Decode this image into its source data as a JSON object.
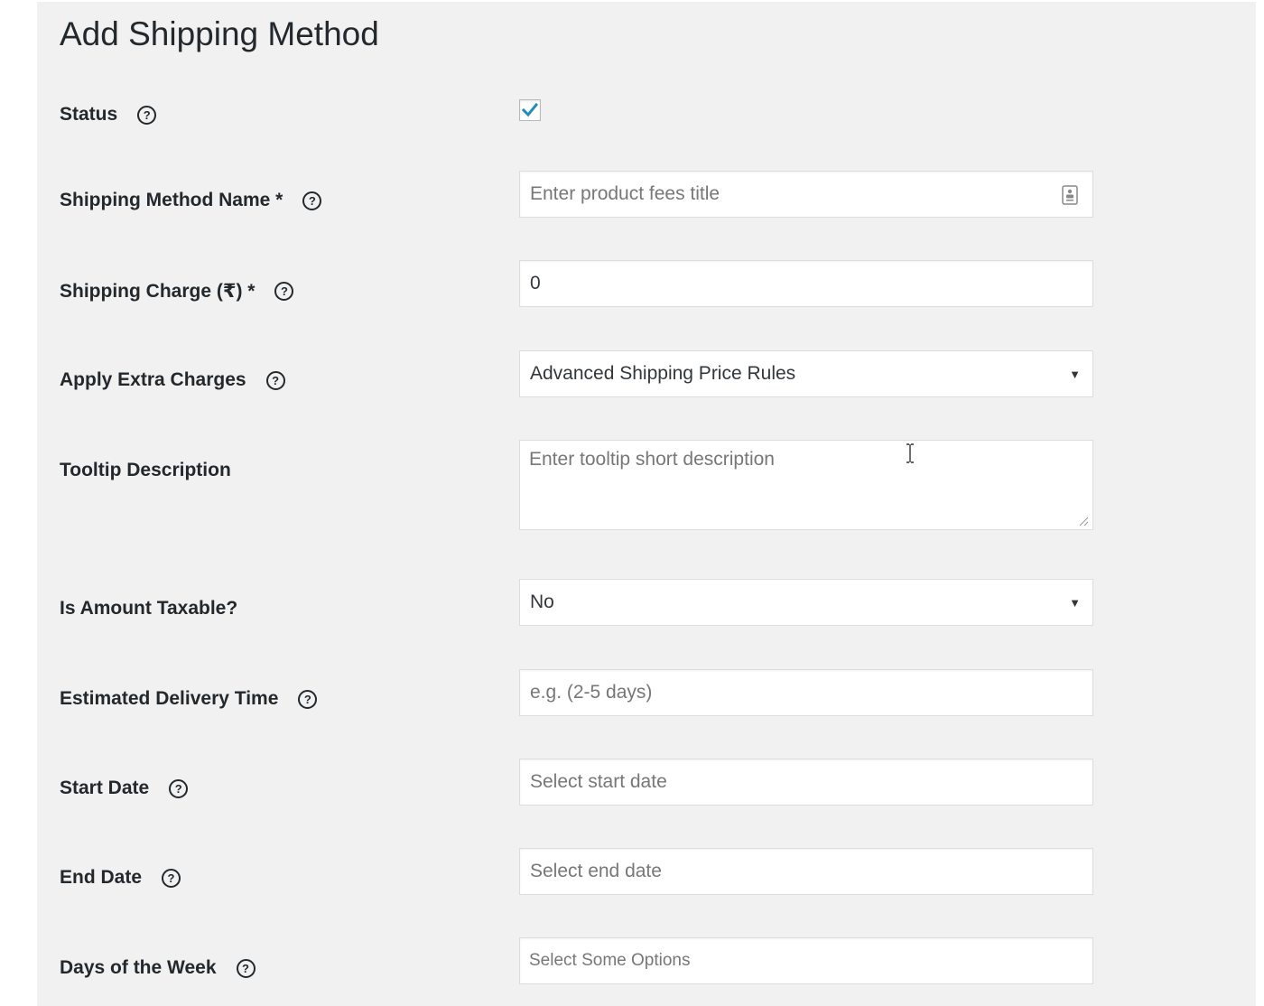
{
  "page": {
    "title": "Add Shipping Method"
  },
  "fields": {
    "status": {
      "label": "Status",
      "checked": true
    },
    "method_name": {
      "label": "Shipping Method Name *",
      "placeholder": "Enter product fees title",
      "value": ""
    },
    "shipping_charge": {
      "label": "Shipping Charge (₹) *",
      "value": "0"
    },
    "apply_extra_charges": {
      "label": "Apply Extra Charges",
      "selected": "Advanced Shipping Price Rules"
    },
    "tooltip_description": {
      "label": "Tooltip Description",
      "placeholder": "Enter tooltip short description"
    },
    "is_taxable": {
      "label": "Is Amount Taxable?",
      "selected": "No"
    },
    "delivery_time": {
      "label": "Estimated Delivery Time",
      "placeholder": "e.g. (2-5 days)"
    },
    "start_date": {
      "label": "Start Date",
      "placeholder": "Select start date"
    },
    "end_date": {
      "label": "End Date",
      "placeholder": "Select end date"
    },
    "days_of_week": {
      "label": "Days of the Week",
      "placeholder": "Select Some Options"
    }
  },
  "icons": {
    "help": "question-circle-icon",
    "checkmark": "checkmark-icon",
    "dropdown": "triangle-down-icon",
    "contact_card": "contact-card-icon"
  },
  "colors": {
    "panel_bg": "#f1f1f1",
    "check_blue": "#1e8cbe",
    "text": "#23282d"
  }
}
